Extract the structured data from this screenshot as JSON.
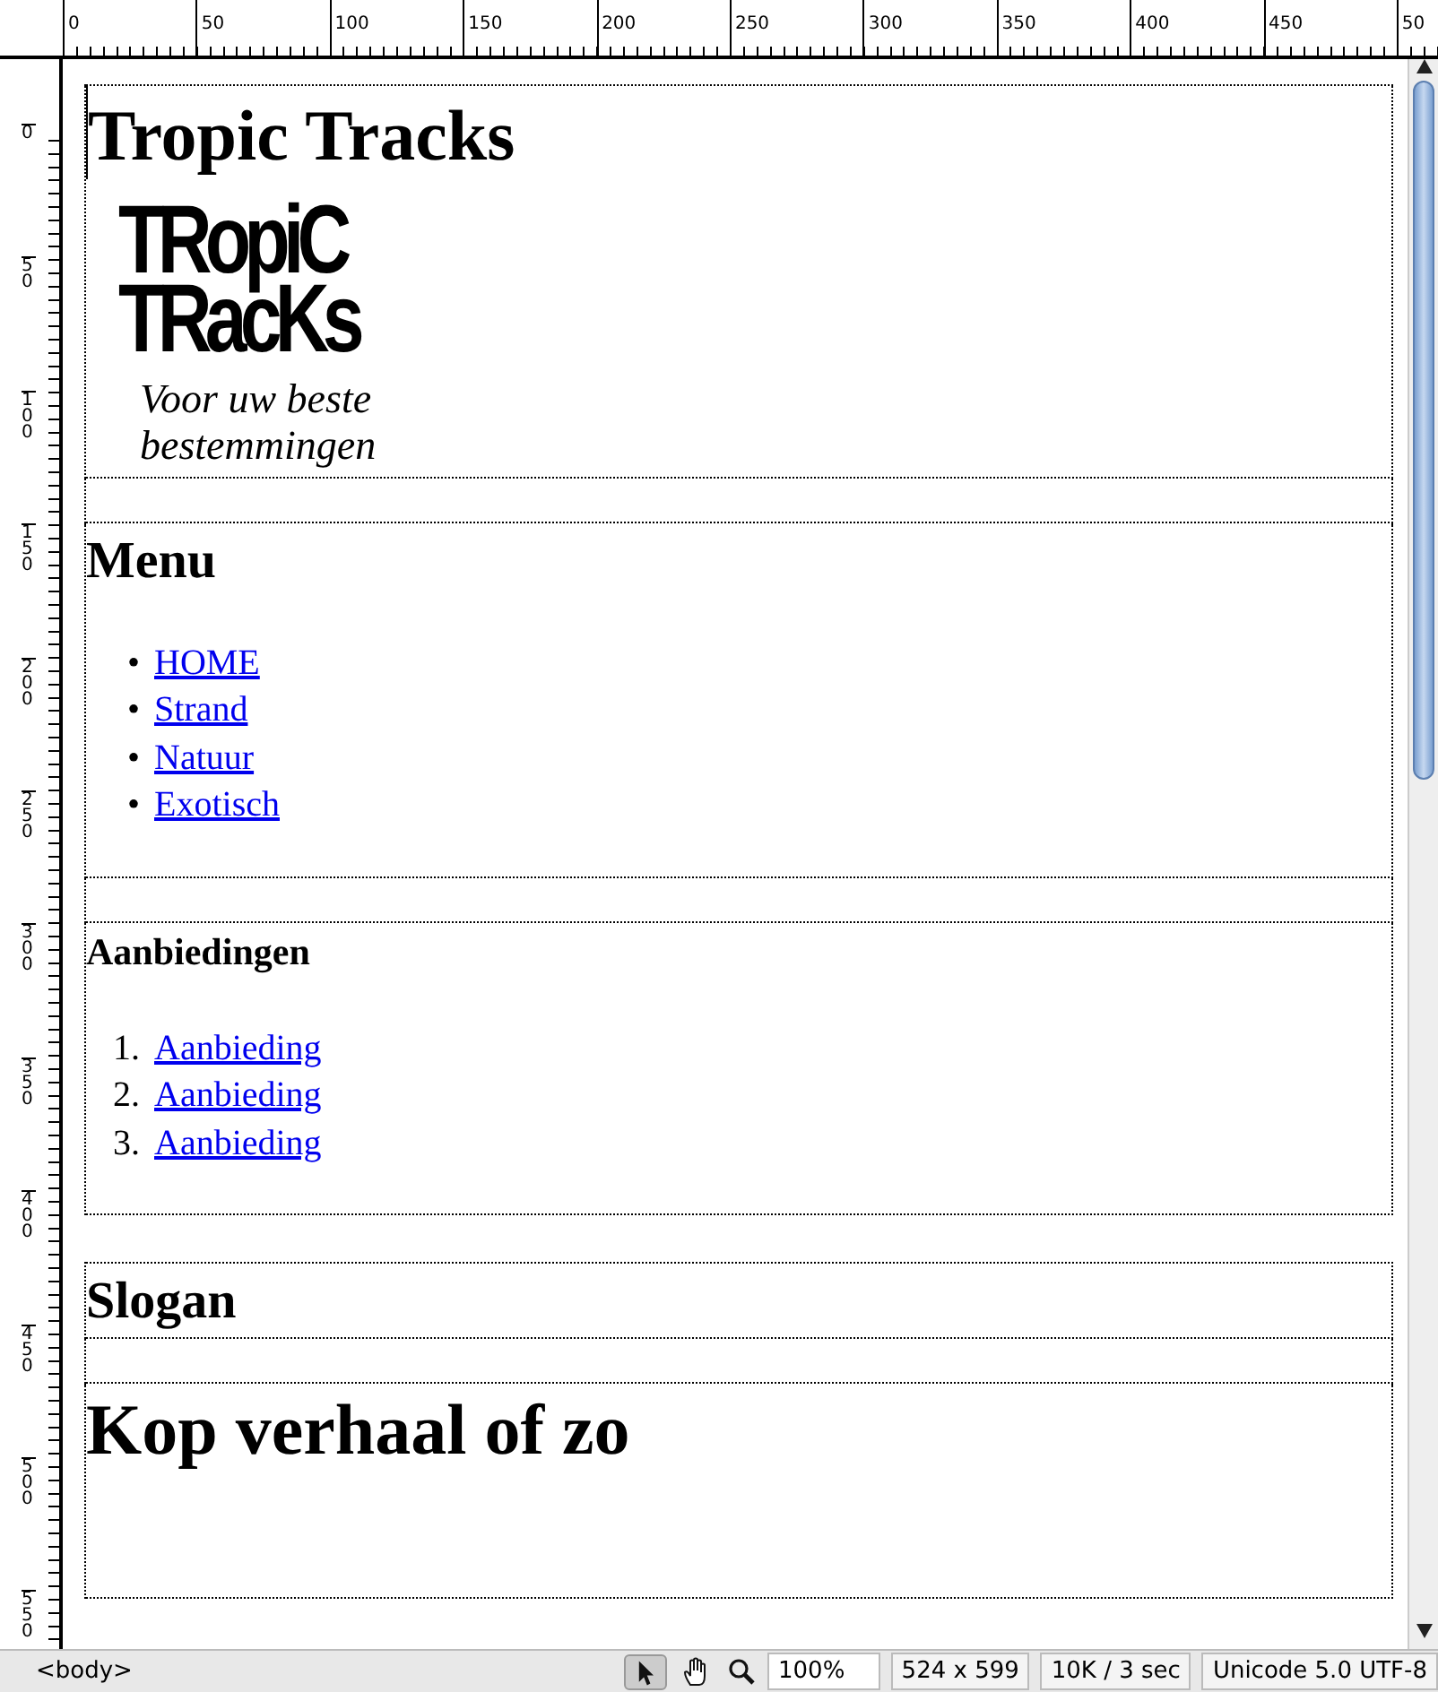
{
  "rulers": {
    "horizontal": [
      "0",
      "50",
      "100",
      "150",
      "200",
      "250",
      "300",
      "350",
      "400",
      "450",
      "50"
    ],
    "vertical": [
      "0",
      "50",
      "100",
      "150",
      "200",
      "250",
      "300",
      "350",
      "400",
      "450",
      "500",
      "550"
    ]
  },
  "document": {
    "sections": [
      {
        "kind": "header",
        "title": "Tropic Tracks",
        "logo_lines": [
          "TRopiC",
          "TRacKs"
        ],
        "tagline": "Voor uw beste bestemmingen"
      },
      {
        "kind": "spacer"
      },
      {
        "kind": "menu",
        "title": "Menu",
        "links": [
          {
            "marker": "•",
            "text": "HOME"
          },
          {
            "marker": "•",
            "text": "Strand"
          },
          {
            "marker": "•",
            "text": "Natuur"
          },
          {
            "marker": "•",
            "text": "Exotisch"
          }
        ]
      },
      {
        "kind": "spacer"
      },
      {
        "kind": "offers",
        "title": "Aanbiedingen",
        "links": [
          {
            "marker": "1.",
            "text": "Aanbieding"
          },
          {
            "marker": "2.",
            "text": "Aanbieding"
          },
          {
            "marker": "3.",
            "text": "Aanbieding"
          }
        ]
      },
      {
        "kind": "gap"
      },
      {
        "kind": "slogan",
        "title": "Slogan"
      },
      {
        "kind": "spacer"
      },
      {
        "kind": "story",
        "title": "Kop verhaal of zo"
      }
    ]
  },
  "status_bar": {
    "tag": "<body>",
    "zoom": "100%",
    "size": "524 x 599",
    "download": "10K / 3 sec",
    "encoding": "Unicode 5.0 UTF-8"
  }
}
